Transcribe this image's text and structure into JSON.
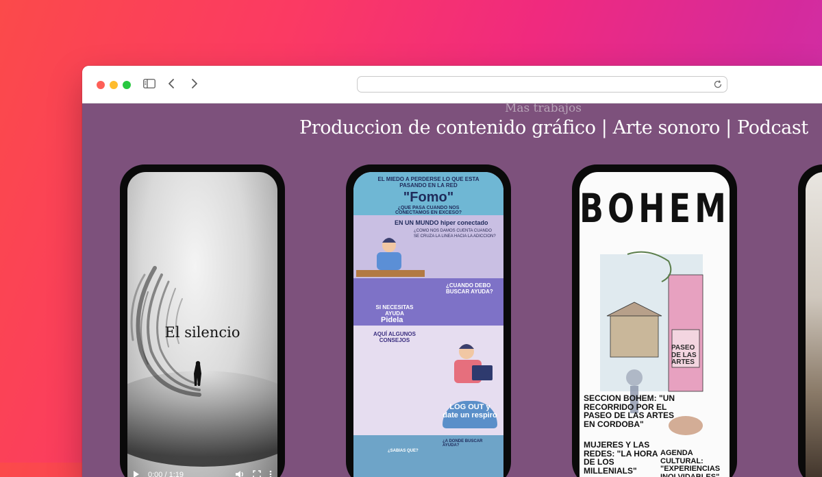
{
  "browser": {
    "url": ""
  },
  "page": {
    "eyebrow": "Mas trabajos",
    "headline": "Produccion de contenido gráfico | Arte sonoro | Podcast"
  },
  "phones": [
    {
      "video_title": "El silencio",
      "time": "0:00 / 1:19"
    },
    {
      "header": "EL MIEDO A PERDERSE LO QUE ESTA PASANDO EN LA RED",
      "title": "\"Fomo\"",
      "subtitle": "¿QUE PASA CUANDO NOS CONECTAMOS EN EXCESO?",
      "section1": "EN UN MUNDO hiper conectado",
      "section1_sub": "¿COMO NOS DAMOS CUENTA CUANDO SE CRUZA LA LINEA HACIA LA ADICCION?",
      "help_q": "¿CUANDO DEBO BUSCAR AYUDA?",
      "need_help": "SI NECESITAS AYUDA",
      "brand": "Pidela",
      "tips": "AQUÍ ALGUNOS CONSEJOS",
      "logout": "LOG OUT y date un respiro",
      "where": "¿A DONDE BUSCAR AYUDA?",
      "did_you_know": "¿SABIAS QUE?"
    },
    {
      "title": "BOHEM",
      "line1": "SECCION BOHEM: \"UN RECORRIDO POR EL PASEO DE LAS ARTES EN CORDOBA\"",
      "line2": "MUJERES Y LAS REDES: \"LA HORA DE LOS MILLENIALS\"",
      "line3": "AGENDA CULTURAL: \"EXPERIENCIAS INOLVIDABLES\"",
      "sign": "PASEO de las ARTES"
    }
  ],
  "colors": {
    "page_bg": "#7d517c",
    "headline": "#ffffff"
  }
}
